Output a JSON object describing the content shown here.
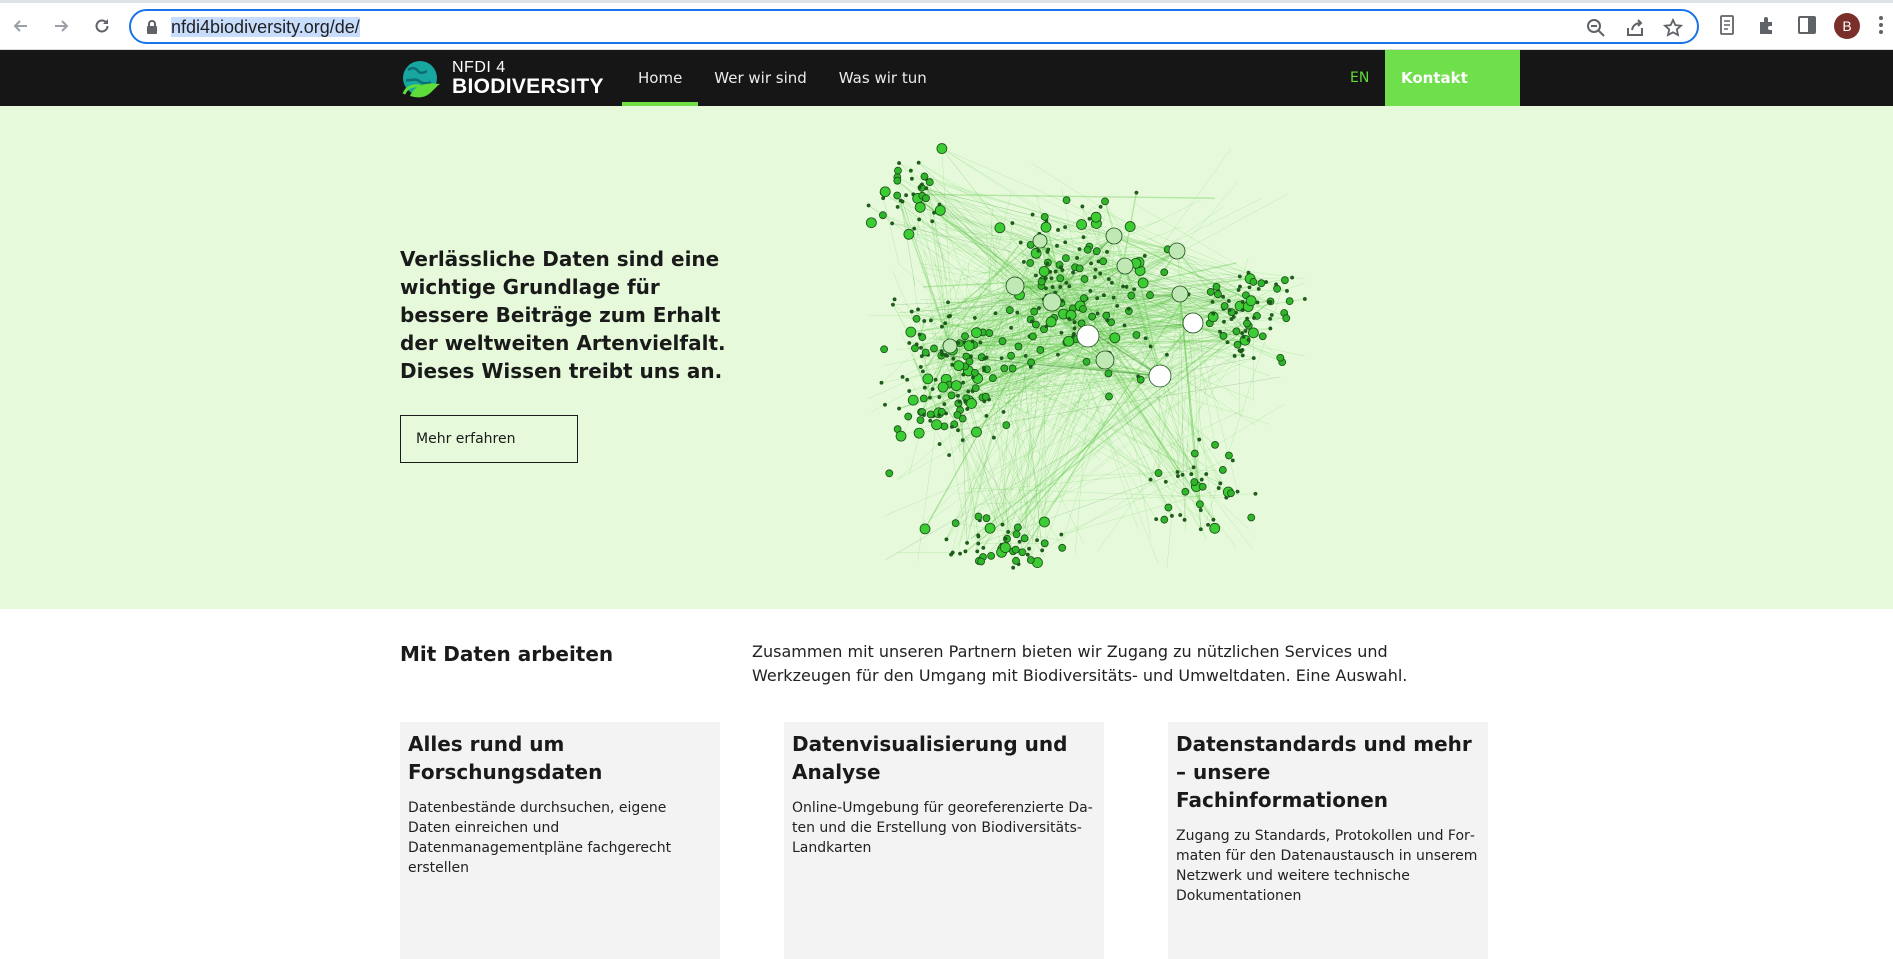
{
  "browser": {
    "url": "nfdi4biodiversity.org/de/",
    "avatar_letter": "B"
  },
  "header": {
    "logo_line1": "NFDI 4",
    "logo_line2": "BIODIVERSITY",
    "nav": [
      {
        "label": "Home",
        "active": true
      },
      {
        "label": "Wer wir sind",
        "active": false
      },
      {
        "label": "Was wir tun",
        "active": false
      }
    ],
    "lang": "EN",
    "contact": "Kontakt",
    "accent": "#6fe04b"
  },
  "hero": {
    "headline": "Verlässliche Daten sind eine wichtige Grundlage für bessere Beiträge zum Erhalt der welt­weiten Artenvielfalt. Dieses Wissen treibt uns an.",
    "button": "Mehr erfahren",
    "background": "#e6fadb"
  },
  "section": {
    "title": "Mit Daten arbeiten",
    "intro": "Zusammen mit unseren Partnern bieten wir Zugang zu nützlichen Services und Werkzeugen für den Umgang mit Biodiversitäts- und Umweltdaten. Eine Auswahl."
  },
  "cards": [
    {
      "title": "Alles rund um Forschungsdaten",
      "text": "Datenbestände durchsuchen, eigene Daten einreichen und Datenmanagementpläne fachgerecht erstellen"
    },
    {
      "title": "Datenvisualisierung und Analyse",
      "text": "Online-Umgebung für georeferenzierte Da­ten und die Erstellung von Biodiversitäts-Landkarten"
    },
    {
      "title": "Datenstandards und mehr – unsere Fachinformationen",
      "text": "Zugang zu Standards, Protokollen und For­maten für den Datenaustausch in unserem Netzwerk und weitere technische Dokumentationen"
    }
  ]
}
